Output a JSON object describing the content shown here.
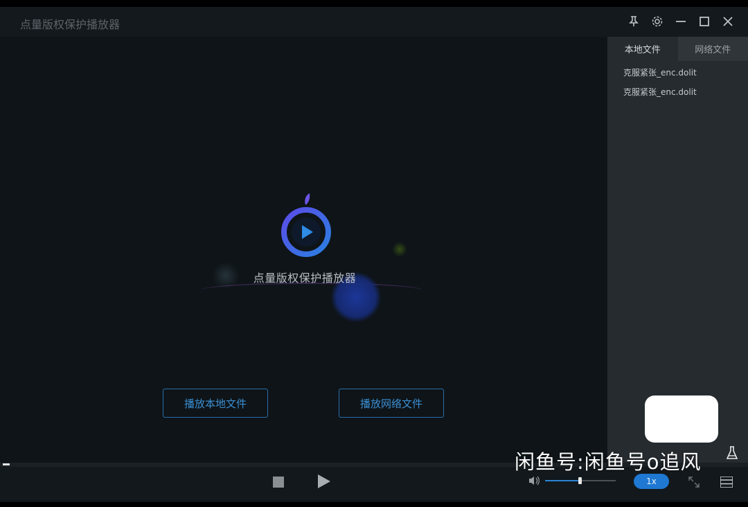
{
  "window": {
    "title": "点量版权保护播放器"
  },
  "titlebar_icons": [
    "pin-icon",
    "gear-icon",
    "minimize-icon",
    "maximize-icon",
    "close-icon"
  ],
  "splash": {
    "logo_text": "点量版权保护播放器"
  },
  "buttons": {
    "play_local": "播放本地文件",
    "play_network": "播放网络文件"
  },
  "sidebar": {
    "tabs": [
      {
        "label": "本地文件",
        "active": true
      },
      {
        "label": "网络文件",
        "active": false
      }
    ],
    "files": [
      "克服紧张_enc.dolit",
      "克服紧张_enc.dolit"
    ]
  },
  "controls": {
    "speed": "1x",
    "volume_fraction": 0.5,
    "progress_fraction": 0.0
  },
  "watermark": {
    "text": "闲鱼号:闲鱼号o追风"
  },
  "colors": {
    "accent": "#1f78d2",
    "button_border": "#2a6ea8",
    "background": "#0e1418",
    "sidebar": "#252b2f"
  }
}
